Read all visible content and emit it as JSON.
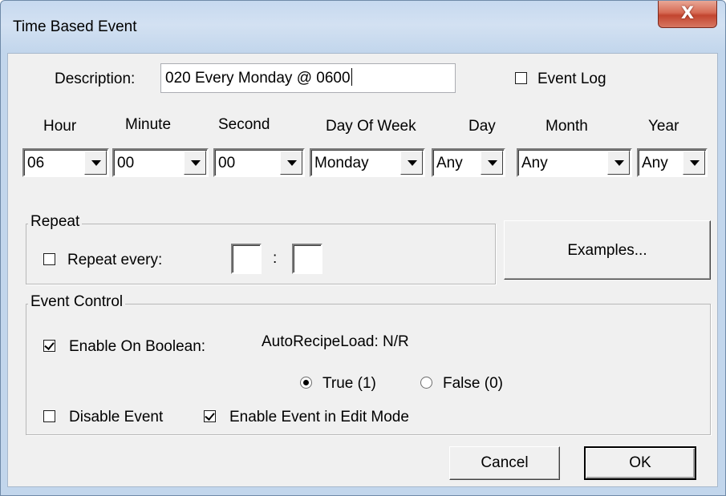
{
  "window": {
    "title": "Time Based Event",
    "close_glyph": "X"
  },
  "form": {
    "description_label": "Description:",
    "description_value": "020 Every Monday @ 0600",
    "event_log": {
      "label": "Event Log",
      "checked": false
    },
    "time_headers": [
      "Hour",
      "Minute",
      "Second",
      "Day Of Week",
      "Day",
      "Month",
      "Year"
    ],
    "time_values": [
      "06",
      "00",
      "00",
      "Monday",
      "Any",
      "Any",
      "Any"
    ]
  },
  "repeat": {
    "group_label": "Repeat",
    "checkbox_label": "Repeat every:",
    "checked": false,
    "separator": ":",
    "hours_value": "",
    "minutes_value": ""
  },
  "examples_button": "Examples...",
  "event_control": {
    "group_label": "Event Control",
    "enable_on_boolean": {
      "label": "Enable On Boolean:",
      "checked": true
    },
    "boolean_name": "AutoRecipeLoad: N/R",
    "true_option": {
      "label": "True (1)",
      "selected": true
    },
    "false_option": {
      "label": "False (0)",
      "selected": false
    },
    "disable_event": {
      "label": "Disable Event",
      "checked": false
    },
    "enable_edit_mode": {
      "label": "Enable Event in Edit Mode",
      "checked": true
    }
  },
  "buttons": {
    "cancel": "Cancel",
    "ok": "OK"
  },
  "icons": {
    "close": "close-icon",
    "dropdown": "chevron-down-icon"
  },
  "colors": {
    "title_bar": "#c6d9ef",
    "close_button": "#c2452f",
    "dialog_face": "#f0f0f0"
  }
}
